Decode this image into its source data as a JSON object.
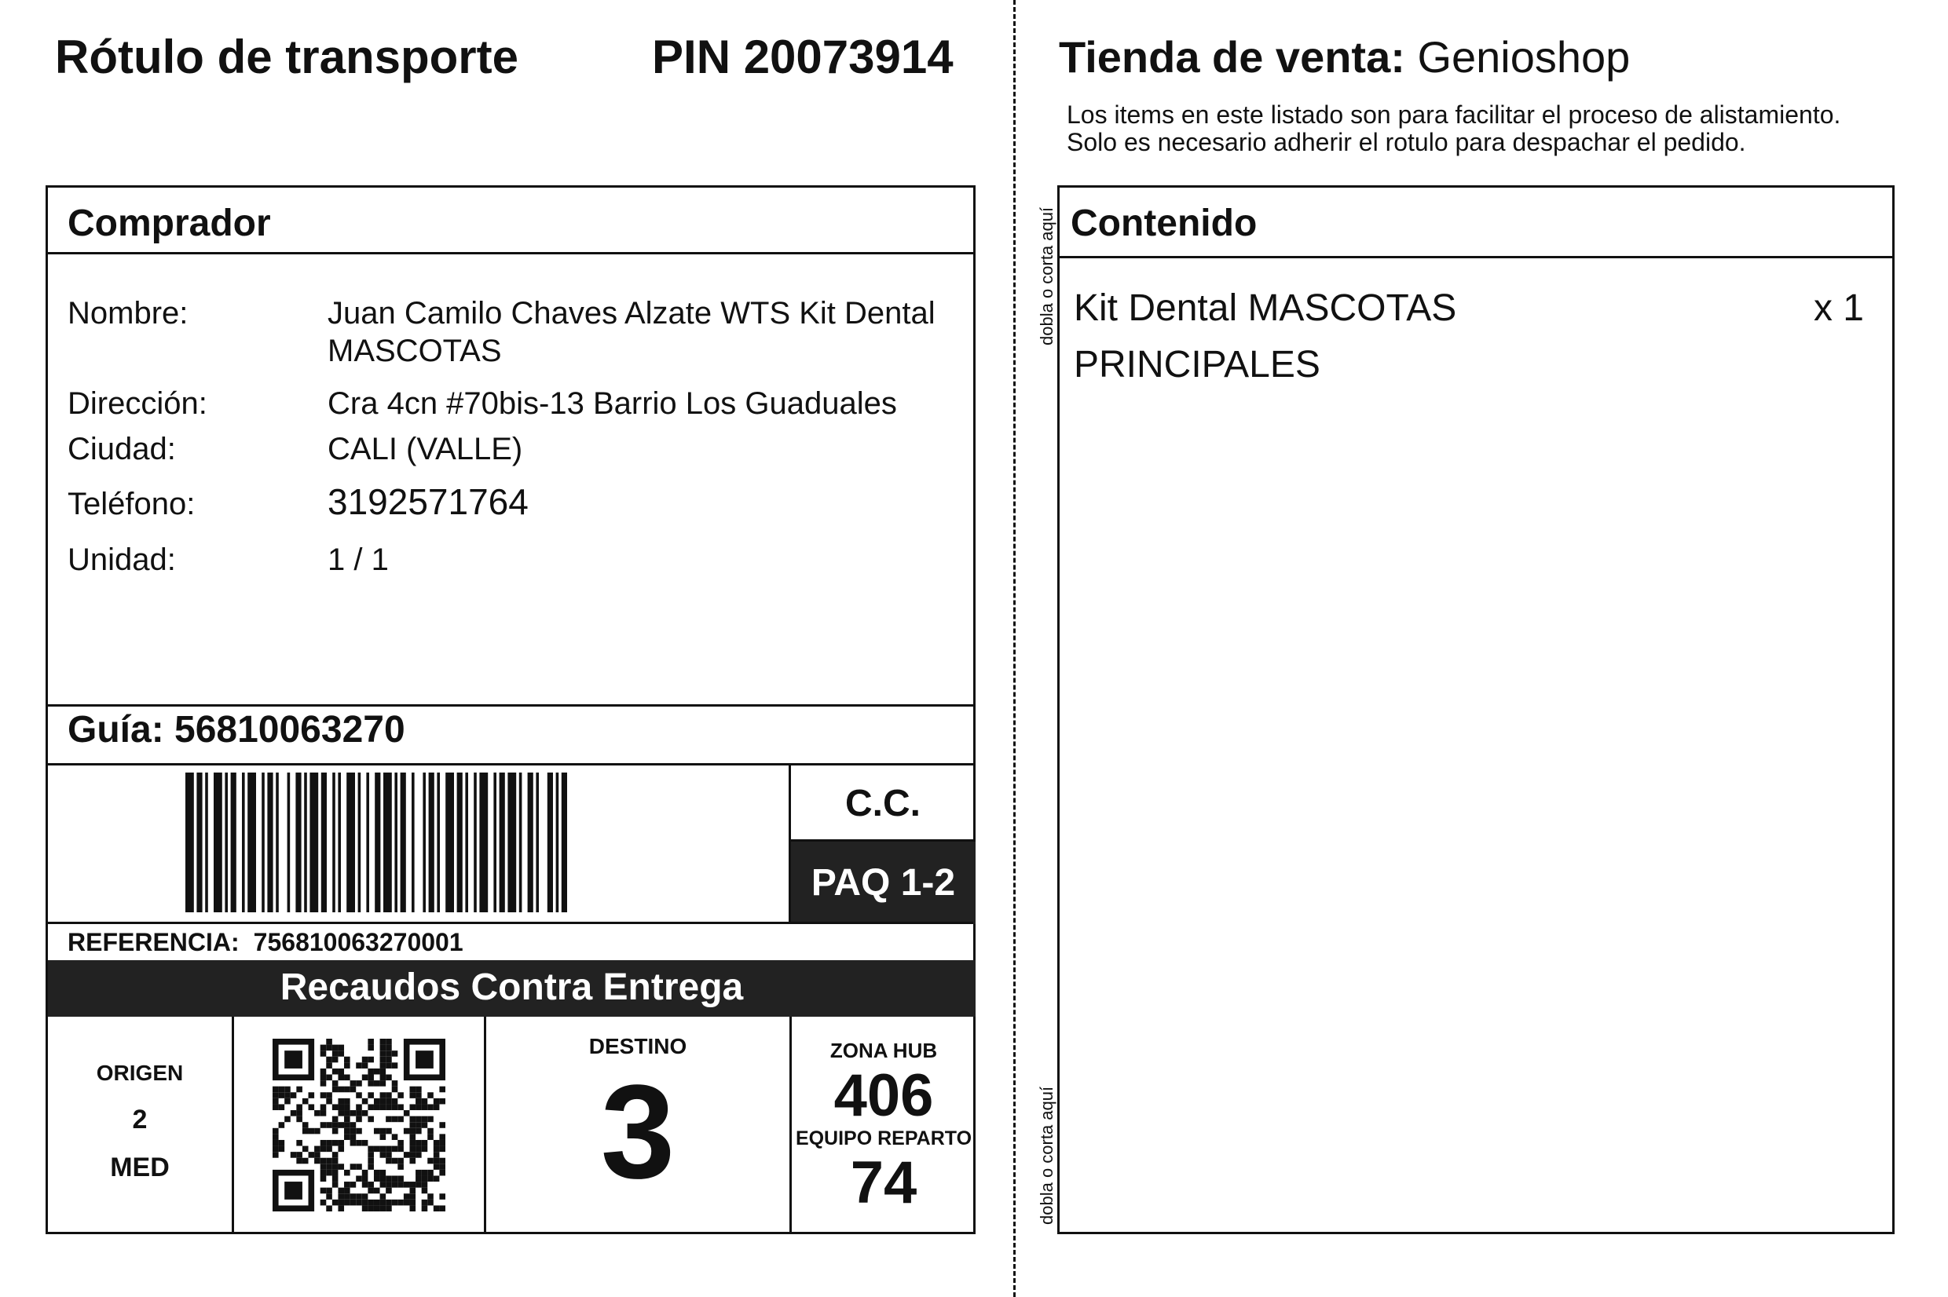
{
  "label": {
    "title": "Rótulo de transporte",
    "pin": "PIN 20073914"
  },
  "buyer": {
    "header": "Comprador",
    "fields": [
      {
        "label": "Nombre:",
        "value": "Juan Camilo Chaves Alzate WTS Kit Dental MASCOTAS"
      },
      {
        "label": "Dirección:",
        "value": "Cra 4cn #70bis-13 Barrio Los Guaduales"
      },
      {
        "label": "Ciudad:",
        "value": "CALI (VALLE)"
      },
      {
        "label": "Teléfono:",
        "value": "3192571764"
      },
      {
        "label": "Unidad:",
        "value": "1 / 1"
      }
    ]
  },
  "shipment": {
    "guia": "Guía: 56810063270",
    "cc": "C.C.",
    "paq": "PAQ 1-2",
    "reference_label": "REFERENCIA:",
    "reference_value": "756810063270001",
    "cod_banner": "Recaudos Contra Entrega",
    "origen_label": "ORIGEN",
    "origen_num": "2",
    "origen_code": "MED",
    "destino_label": "DESTINO",
    "destino_value": "3",
    "zona_label": "ZONA HUB",
    "zona_value": "406",
    "equipo_label": "EQUIPO REPARTO",
    "equipo_value": "74"
  },
  "separator": {
    "fold_text": "dobla o corta aquí"
  },
  "store": {
    "label": "Tienda de venta:",
    "name": "Genioshop",
    "note_line1": "Los items en este listado son para facilitar el proceso de alistamiento.",
    "note_line2": "Solo es necesario adherir el rotulo para despachar el pedido."
  },
  "contents": {
    "header": "Contenido",
    "items": [
      {
        "name": "Kit Dental MASCOTAS PRINCIPALES",
        "qty": "x 1"
      }
    ]
  }
}
